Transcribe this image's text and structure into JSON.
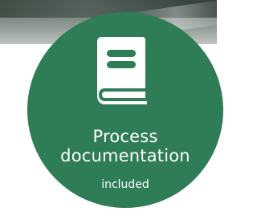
{
  "badge": {
    "title_line1": "Process",
    "title_line2": "documentation",
    "subtitle": "included",
    "icon": "book-icon",
    "color": "#2e7d57"
  }
}
